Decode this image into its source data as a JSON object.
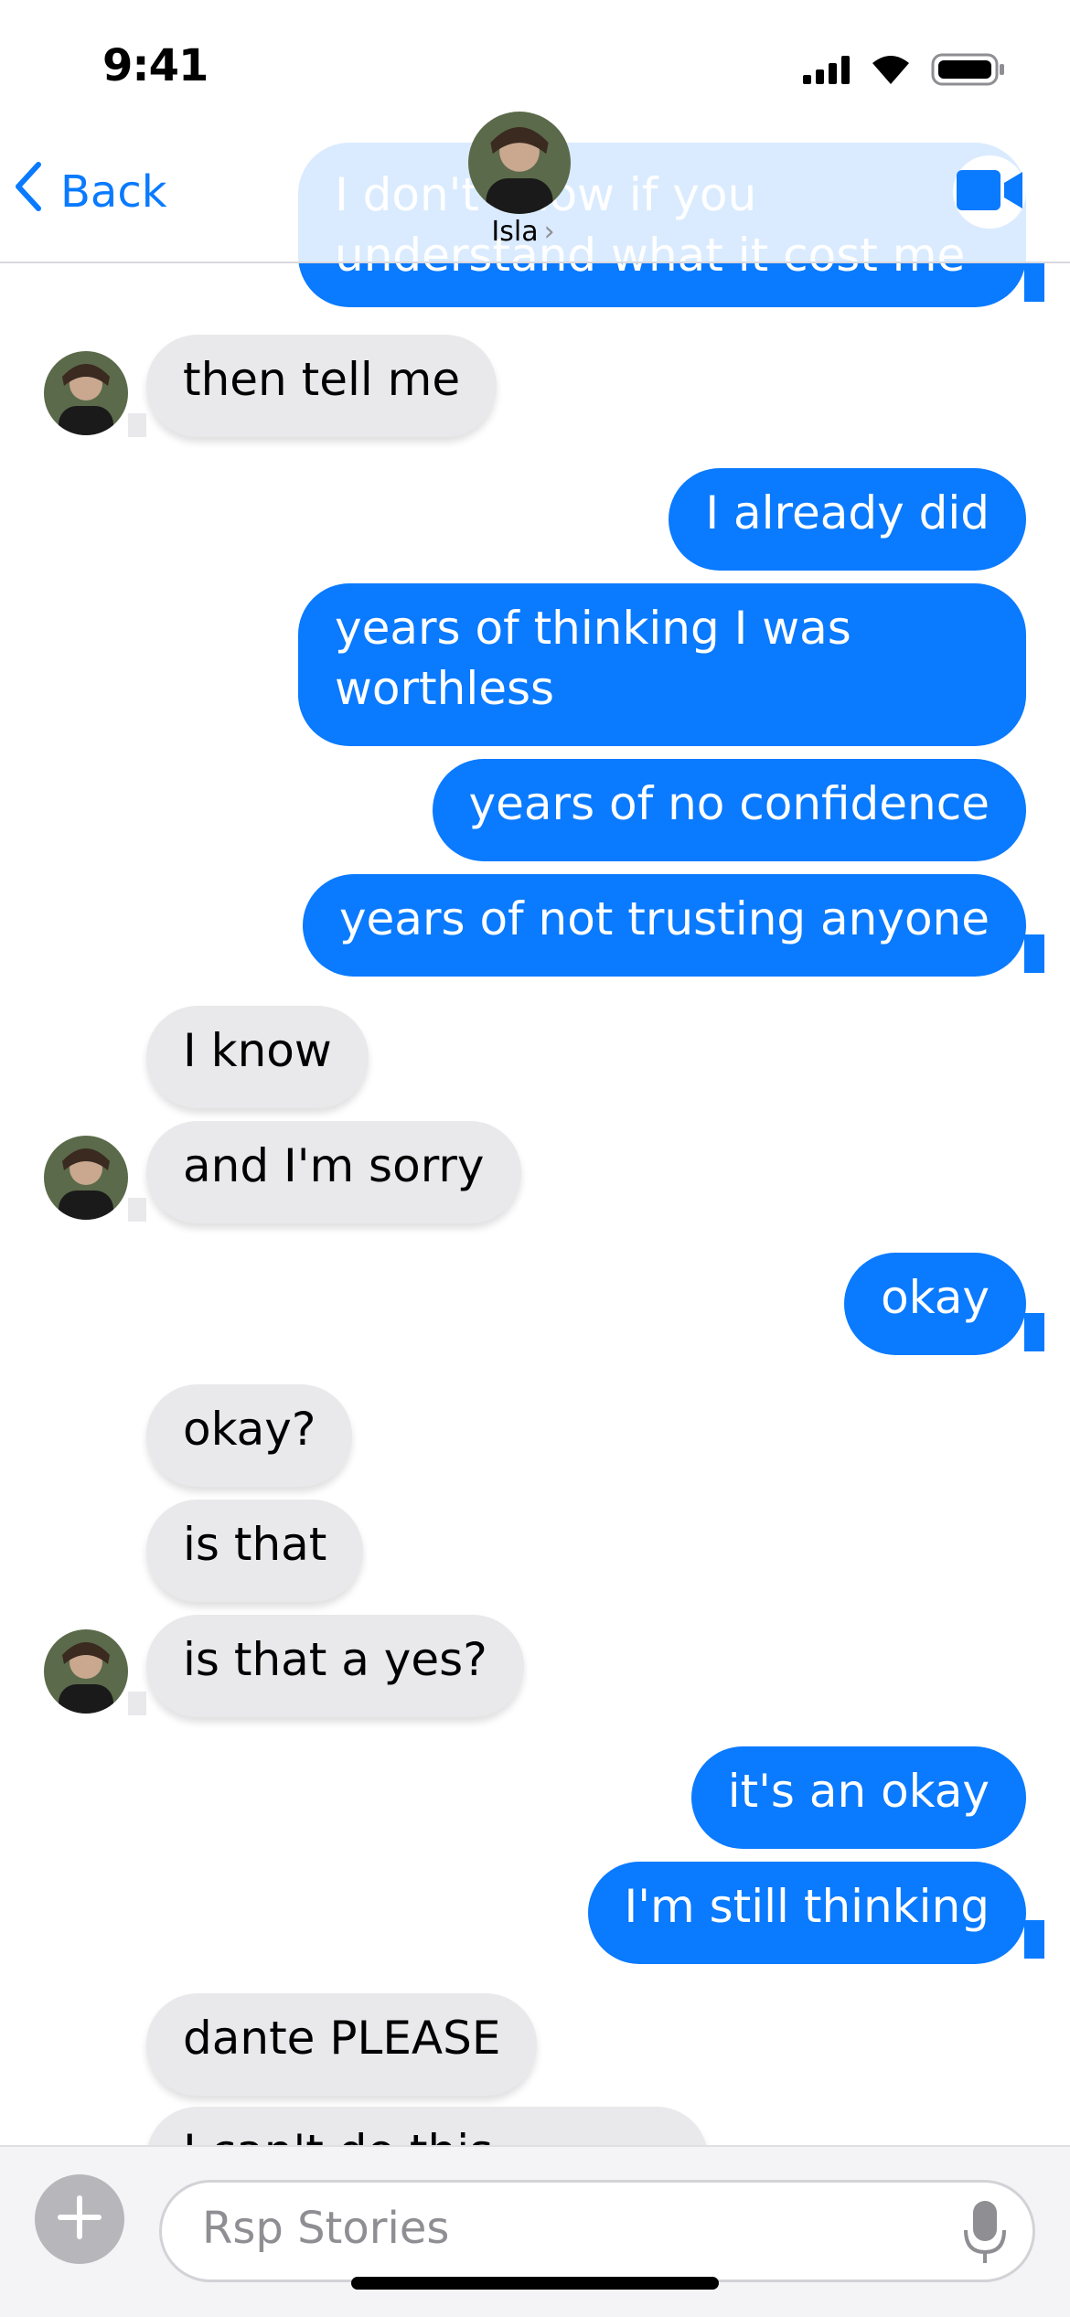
{
  "status": {
    "time": "9:41"
  },
  "nav": {
    "back_label": "Back",
    "contact_name": "Isla",
    "contact_chevron": "›"
  },
  "messages": [
    {
      "side": "sent",
      "text": "I don't know if you understand what it cost me"
    },
    {
      "side": "received",
      "text": "then tell me"
    },
    {
      "side": "sent",
      "text": "I already did"
    },
    {
      "side": "sent",
      "text": "years of thinking I was"
    },
    {
      "side": "sent",
      "text": "worthless"
    },
    {
      "side": "sent",
      "text": "years of no confidence"
    },
    {
      "side": "sent",
      "text": "years of not trusting anyone"
    },
    {
      "side": "received",
      "text": "I know"
    },
    {
      "side": "received",
      "text": "and I'm sorry"
    },
    {
      "side": "sent",
      "text": "okay"
    },
    {
      "side": "received",
      "text": "okay?"
    },
    {
      "side": "received",
      "text": "is that"
    },
    {
      "side": "received",
      "text": "is that a yes?"
    },
    {
      "side": "sent",
      "text": "it's an okay"
    },
    {
      "side": "sent",
      "text": "I'm still thinking"
    },
    {
      "side": "received",
      "text": "dante PLEASE"
    },
    {
      "side": "received",
      "text": "I can't do this"
    }
  ],
  "composer": {
    "placeholder": "Rsp Stories"
  },
  "icons": {
    "back": "chevron-left-icon",
    "video": "video-camera-icon",
    "add": "plus-icon",
    "mic": "microphone-icon",
    "signal": "cellular-signal-icon",
    "wifi": "wifi-icon",
    "battery": "battery-icon"
  },
  "colors": {
    "accent": "#0a7aff",
    "received_bubble": "#e9e9eb",
    "sent_bubble": "#0a7aff"
  }
}
